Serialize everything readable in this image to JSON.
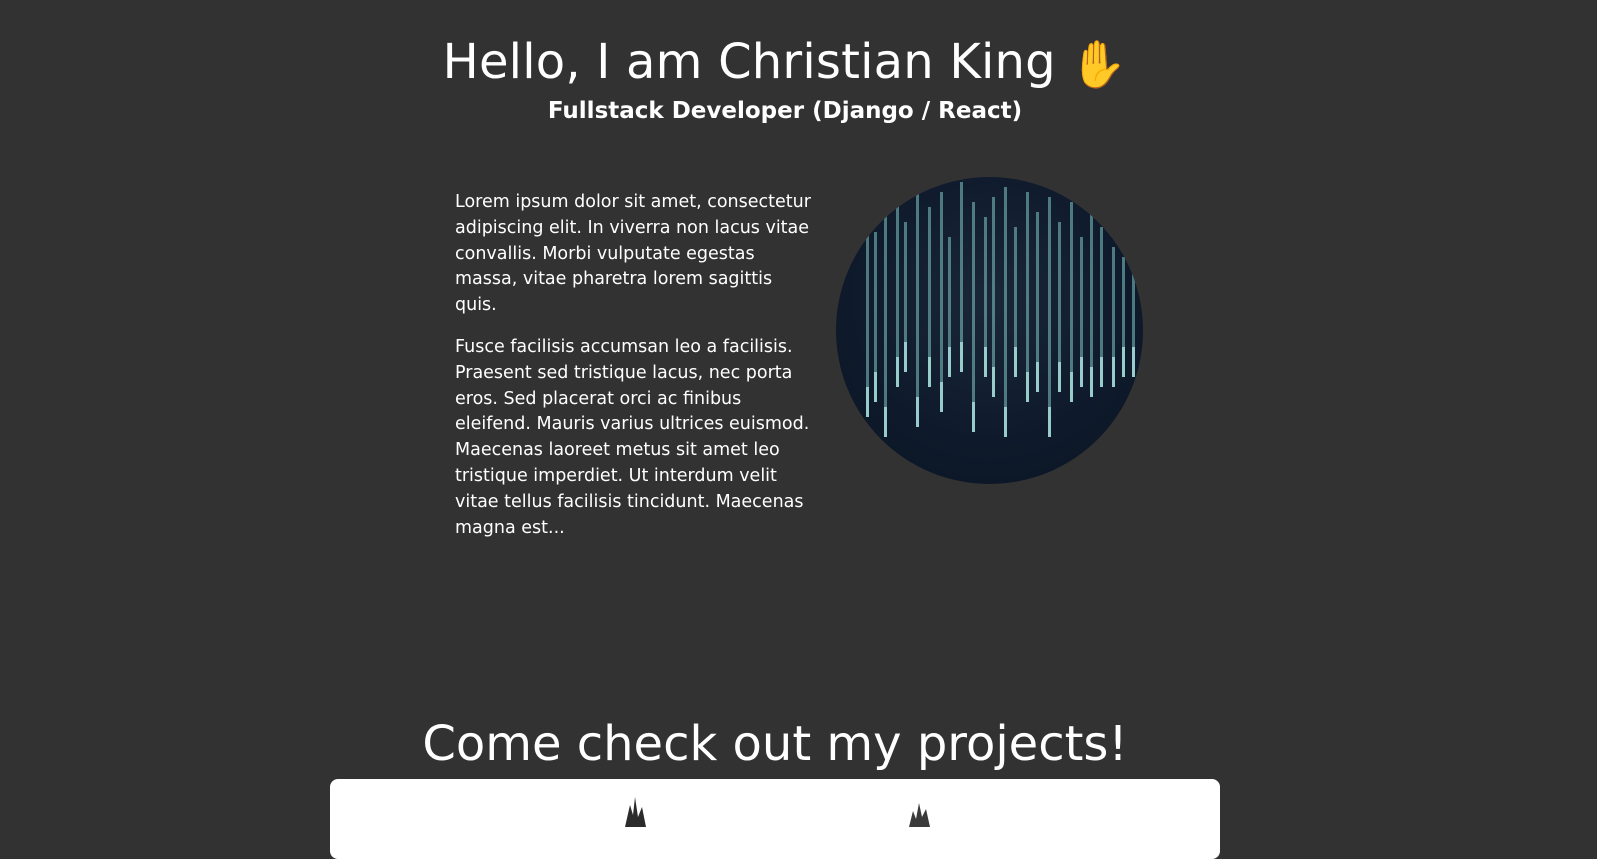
{
  "hero": {
    "title": "Hello, I am Christian King",
    "wave_emoji": "✋",
    "subtitle": "Fullstack Developer (Django / React)"
  },
  "about": {
    "paragraphs": [
      "Lorem ipsum dolor sit amet, consectetur adipiscing elit. In viverra non lacus vitae convallis. Morbi vulputate egestas massa, vitae pharetra lorem sagittis quis.",
      "Fusce facilisis accumsan leo a facilisis. Praesent sed tristique lacus, nec porta eros. Sed placerat orci ac finibus eleifend. Mauris varius ultrices euismod. Maecenas laoreet metus sit amet leo tristique imperdiet. Ut interdum velit vitae tellus facilisis tincidunt. Maecenas magna est..."
    ]
  },
  "projects": {
    "heading": "Come check out my projects!"
  },
  "colors": {
    "background": "#333233",
    "text": "#ffffff",
    "card": "#ffffff",
    "avatar_bg": "#0e1a2b",
    "avatar_streak": "#7fc8c4"
  }
}
